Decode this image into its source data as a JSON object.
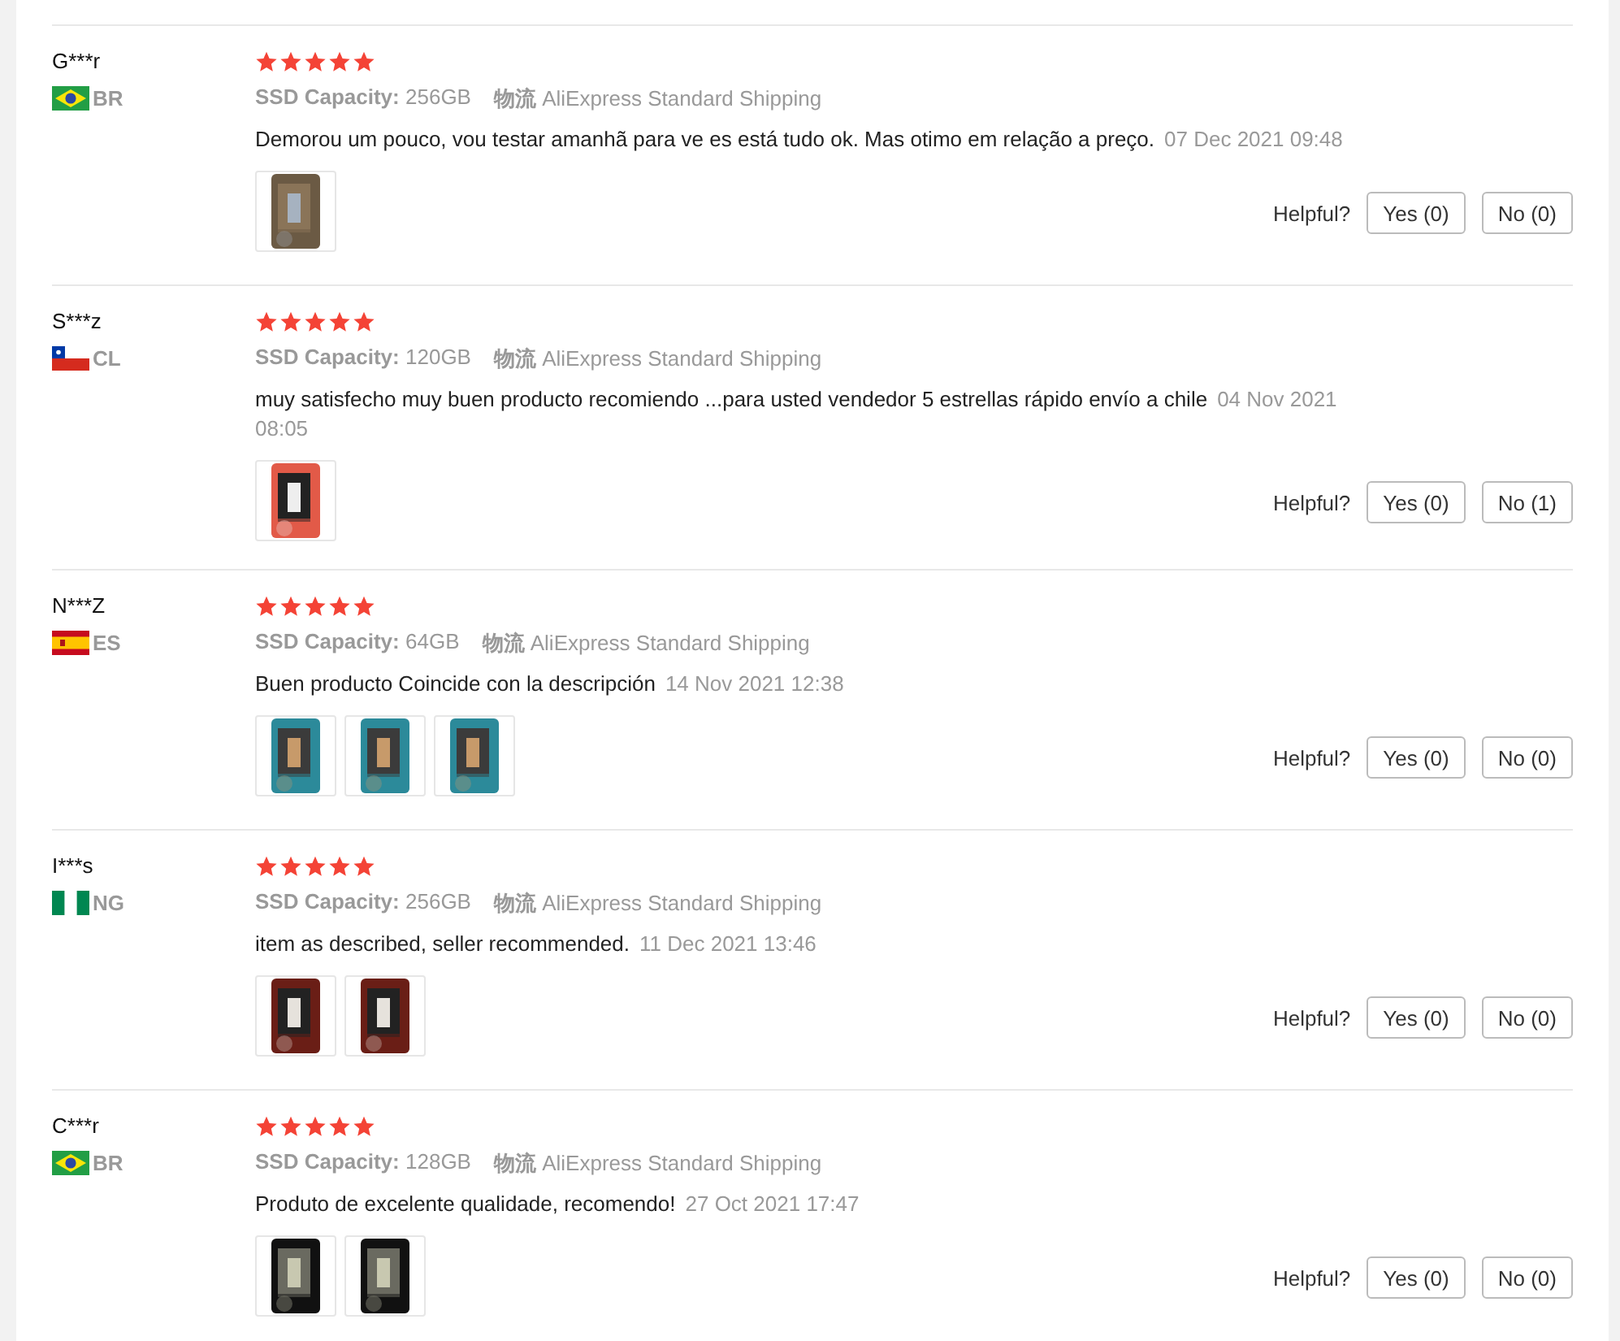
{
  "reviews": [
    {
      "user": "G***r",
      "flag": {
        "kind": "brazil"
      },
      "country": "BR",
      "stars": 5,
      "capacity_label": "SSD Capacity:",
      "capacity": "256GB",
      "shipping_label": "物流",
      "shipping": "AliExpress Standard Shipping",
      "comment": "Demorou um pouco, vou testar amanhã para ve es está tudo ok. Mas otimo em relação a preço.",
      "date": "07 Dec 2021 09:48",
      "photos": [
        {
          "kind": "picture"
        }
      ],
      "helpful_label": "Helpful?",
      "yes": "Yes (0)",
      "no": "No (0)"
    },
    {
      "user": "S***z",
      "flag": {
        "kind": "chile"
      },
      "country": "CL",
      "stars": 5,
      "capacity_label": "SSD Capacity:",
      "capacity": "120GB",
      "shipping_label": "物流",
      "shipping": "AliExpress Standard Shipping",
      "comment": "muy satisfecho muy buen producto recomiendo ...para usted vendedor 5 estrellas rápido envío a chile",
      "date": "04 Nov 2021 08:05",
      "photos": [
        {
          "kind": "picture"
        }
      ],
      "helpful_label": "Helpful?",
      "yes": "Yes (0)",
      "no": "No (1)"
    },
    {
      "user": "N***Z",
      "flag": {
        "kind": "spain"
      },
      "country": "ES",
      "stars": 5,
      "capacity_label": "SSD Capacity:",
      "capacity": "64GB",
      "shipping_label": "物流",
      "shipping": "AliExpress Standard Shipping",
      "comment": "Buen producto Coincide con la descripción",
      "date": "14 Nov 2021 12:38",
      "photos": [
        {
          "kind": "picture"
        },
        {
          "kind": "picture"
        },
        {
          "kind": "picture"
        }
      ],
      "helpful_label": "Helpful?",
      "yes": "Yes (0)",
      "no": "No (0)"
    },
    {
      "user": "I***s",
      "flag": {
        "kind": "nigeria"
      },
      "country": "NG",
      "stars": 5,
      "capacity_label": "SSD Capacity:",
      "capacity": "256GB",
      "shipping_label": "物流",
      "shipping": "AliExpress Standard Shipping",
      "comment": "item as described, seller recommended.",
      "date": "11 Dec 2021 13:46",
      "photos": [
        {
          "kind": "picture"
        },
        {
          "kind": "picture"
        }
      ],
      "helpful_label": "Helpful?",
      "yes": "Yes (0)",
      "no": "No (0)"
    },
    {
      "user": "C***r",
      "flag": {
        "kind": "brazil"
      },
      "country": "BR",
      "stars": 5,
      "capacity_label": "SSD Capacity:",
      "capacity": "128GB",
      "shipping_label": "物流",
      "shipping": "AliExpress Standard Shipping",
      "comment": "Produto de excelente qualidade, recomendo!",
      "date": "27 Oct 2021 17:47",
      "photos": [
        {
          "kind": "picture"
        },
        {
          "kind": "picture"
        }
      ],
      "helpful_label": "Helpful?",
      "yes": "Yes (0)",
      "no": "No (0)"
    }
  ]
}
